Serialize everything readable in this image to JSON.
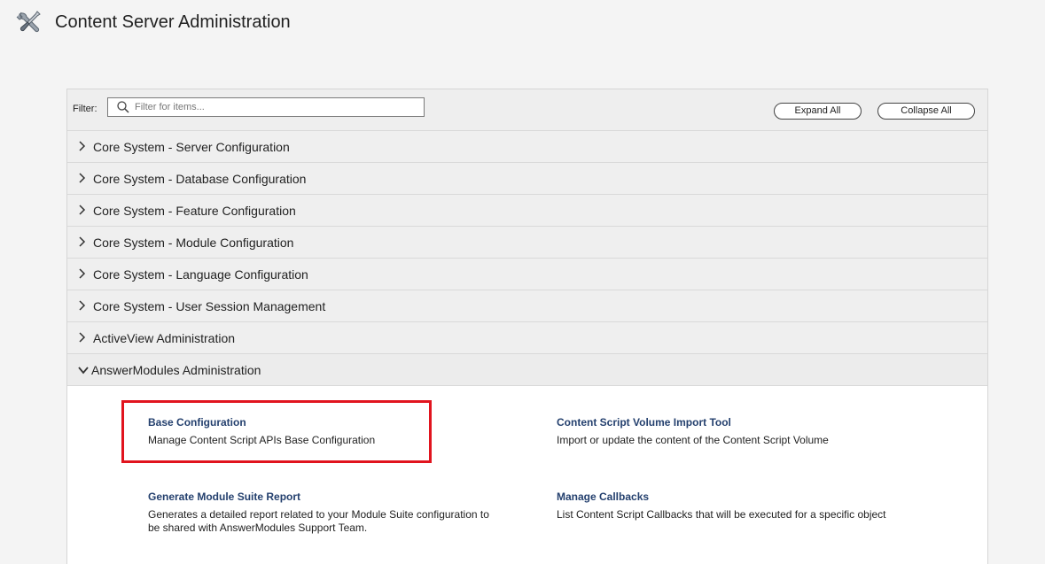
{
  "header": {
    "title": "Content Server Administration",
    "icon": "tools-icon"
  },
  "toolbar": {
    "filter_label": "Filter:",
    "filter_placeholder": "Filter for items...",
    "filter_value": "",
    "expand_all": "Expand All",
    "collapse_all": "Collapse All"
  },
  "sections": [
    {
      "label": "Core System - Server Configuration",
      "expanded": false
    },
    {
      "label": "Core System - Database Configuration",
      "expanded": false
    },
    {
      "label": "Core System - Feature Configuration",
      "expanded": false
    },
    {
      "label": "Core System - Module Configuration",
      "expanded": false
    },
    {
      "label": "Core System - Language Configuration",
      "expanded": false
    },
    {
      "label": "Core System - User Session Management",
      "expanded": false
    },
    {
      "label": "ActiveView Administration",
      "expanded": false
    },
    {
      "label": "AnswerModules Administration",
      "expanded": true
    }
  ],
  "items": [
    {
      "title": "Base Configuration",
      "desc": "Manage Content Script APIs Base Configuration"
    },
    {
      "title": "Content Script Volume Import Tool",
      "desc": "Import or update the content of the Content Script Volume"
    },
    {
      "title": "Generate Module Suite Report",
      "desc": "Generates a detailed report related to your Module Suite configuration to be shared with AnswerModules Support Team."
    },
    {
      "title": "Manage Callbacks",
      "desc": "List Content Script Callbacks that will be executed for a specific object"
    }
  ],
  "colors": {
    "link": "#24406e",
    "highlight": "#e1141e",
    "row_bg": "#efefef"
  }
}
